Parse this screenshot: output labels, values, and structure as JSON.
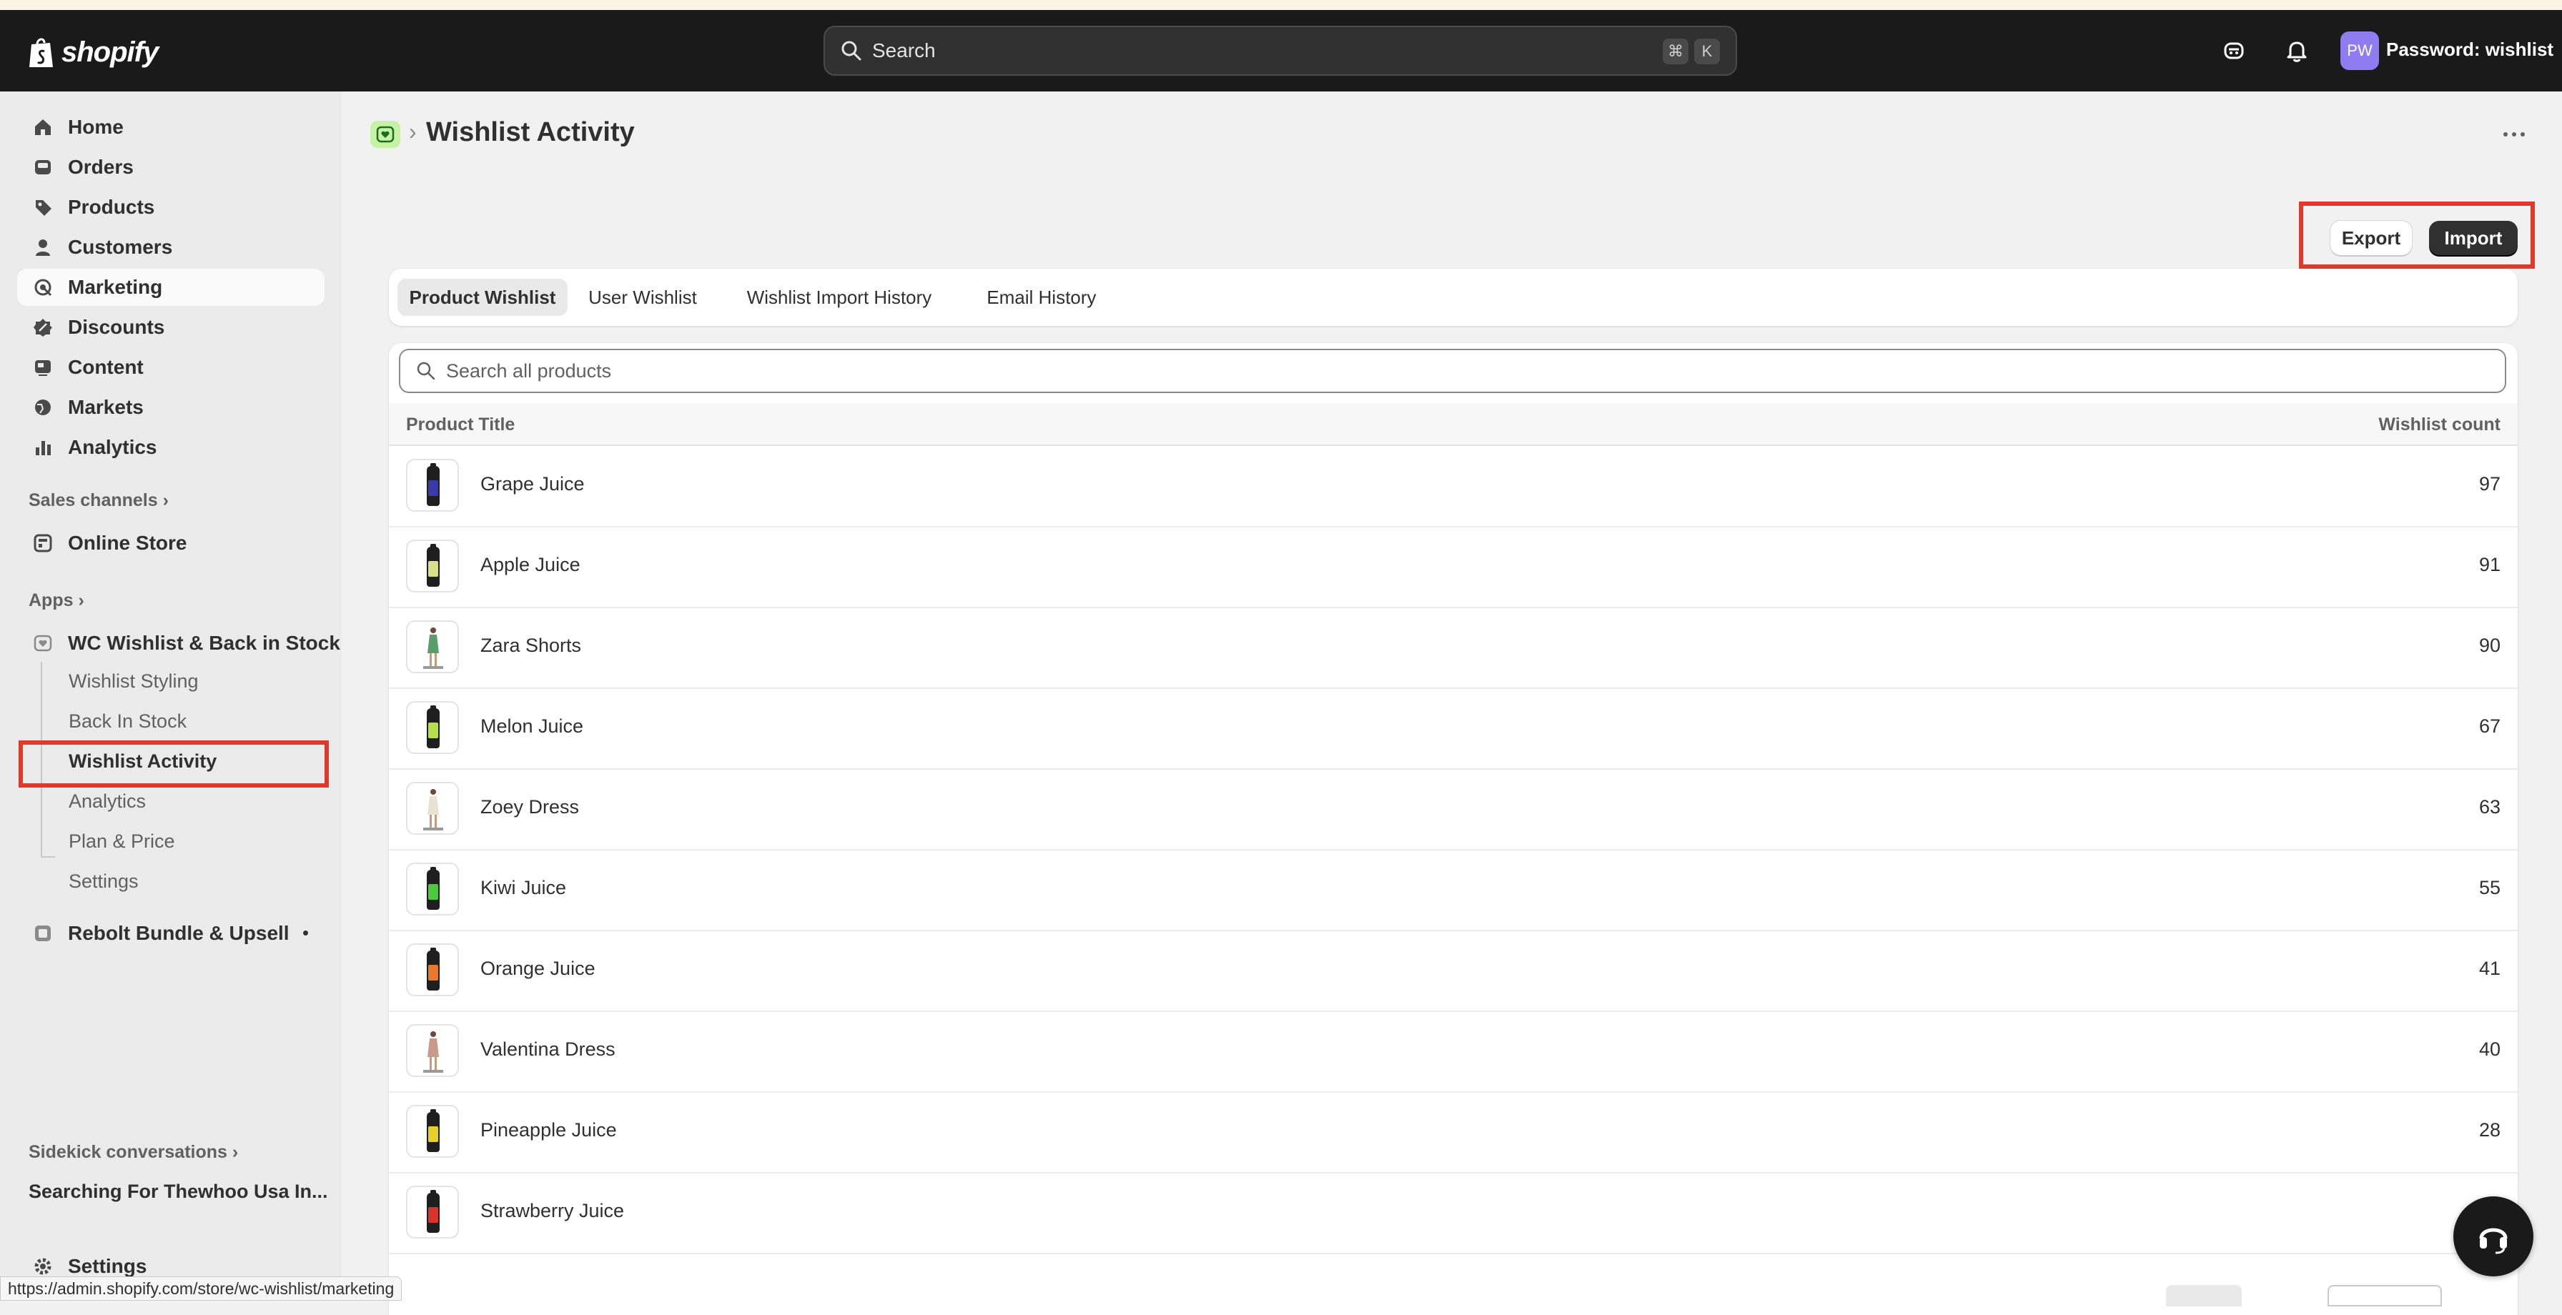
{
  "topbar": {
    "brand": "shopify",
    "search_placeholder": "Search",
    "shortcut_keys": [
      "⌘",
      "K"
    ],
    "avatar_initials": "PW",
    "store_name": "Password: wishlist"
  },
  "sidebar": {
    "nav": [
      {
        "label": "Home",
        "icon": "home-icon"
      },
      {
        "label": "Orders",
        "icon": "inbox-icon"
      },
      {
        "label": "Products",
        "icon": "tag-icon"
      },
      {
        "label": "Customers",
        "icon": "person-icon"
      },
      {
        "label": "Marketing",
        "icon": "target-icon",
        "active": true
      },
      {
        "label": "Discounts",
        "icon": "discount-icon"
      },
      {
        "label": "Content",
        "icon": "content-icon"
      },
      {
        "label": "Markets",
        "icon": "globe-icon"
      },
      {
        "label": "Analytics",
        "icon": "bar-chart-icon"
      }
    ],
    "sales_channels_heading": "Sales channels",
    "online_store": "Online Store",
    "apps_heading": "Apps",
    "app_name": "WC Wishlist & Back in Stock",
    "app_subitems": [
      "Wishlist Styling",
      "Back In Stock",
      "Wishlist Activity",
      "Analytics",
      "Plan & Price",
      "Settings"
    ],
    "rebolt": "Rebolt Bundle & Upsell",
    "sidekick_heading": "Sidekick conversations",
    "sidekick_item": "Searching For Thewhoo Usa In...",
    "settings": "Settings"
  },
  "page": {
    "title": "Wishlist Activity",
    "export_label": "Export",
    "import_label": "Import",
    "tabs": [
      "Product Wishlist",
      "User Wishlist",
      "Wishlist Import History",
      "Email History"
    ],
    "active_tab": "Product Wishlist",
    "search_placeholder": "Search all products",
    "col_title": "Product Title",
    "col_count": "Wishlist count",
    "rows": [
      {
        "name": "Grape Juice",
        "count": "97",
        "kind": "bottle",
        "color": "#3a3aa8"
      },
      {
        "name": "Apple Juice",
        "count": "91",
        "kind": "bottle",
        "color": "#d8e08a"
      },
      {
        "name": "Zara Shorts",
        "count": "90",
        "kind": "apparel",
        "color": "#5a9c6a"
      },
      {
        "name": "Melon Juice",
        "count": "67",
        "kind": "bottle",
        "color": "#b6e04a"
      },
      {
        "name": "Zoey Dress",
        "count": "63",
        "kind": "apparel",
        "color": "#e8e2d2"
      },
      {
        "name": "Kiwi Juice",
        "count": "55",
        "kind": "bottle",
        "color": "#4cc83e"
      },
      {
        "name": "Orange Juice",
        "count": "41",
        "kind": "bottle",
        "color": "#e8782a"
      },
      {
        "name": "Valentina Dress",
        "count": "40",
        "kind": "apparel",
        "color": "#c99a8a"
      },
      {
        "name": "Pineapple Juice",
        "count": "28",
        "kind": "bottle",
        "color": "#e8d02a"
      },
      {
        "name": "Strawberry Juice",
        "count": "",
        "kind": "bottle",
        "color": "#d8342a"
      }
    ]
  },
  "statusbar_url": "https://admin.shopify.com/store/wc-wishlist/marketing",
  "colors": {
    "highlight": "#e0392b",
    "topbar": "#1a1a1a",
    "sidebar": "#ebebeb"
  }
}
